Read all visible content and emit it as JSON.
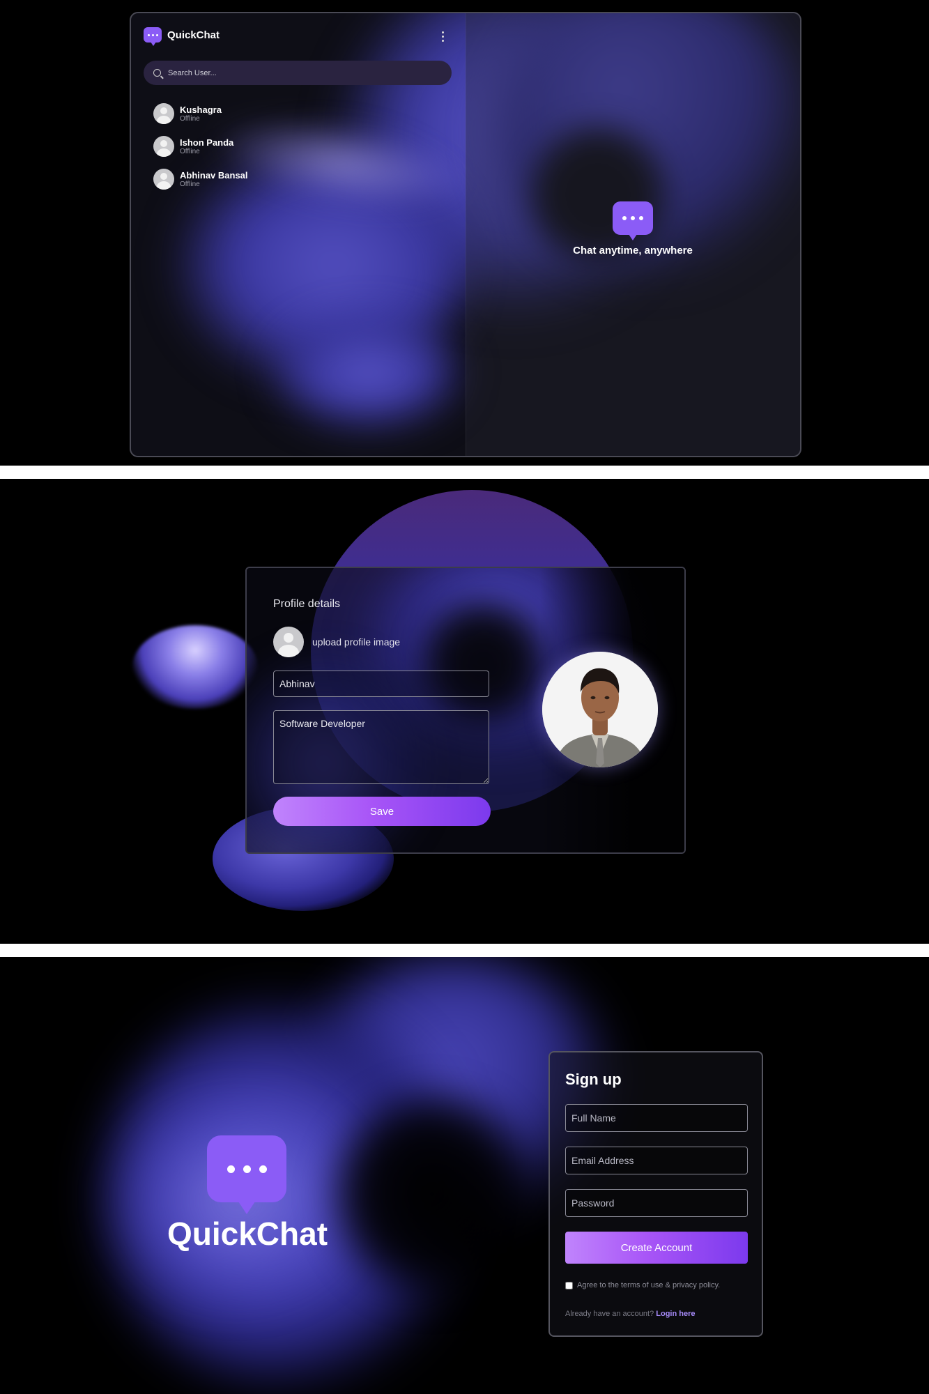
{
  "chat_screen": {
    "app_name": "QuickChat",
    "menu_icon": "vertical-dots-icon",
    "search": {
      "placeholder": "Search User...",
      "icon": "search-icon"
    },
    "users": [
      {
        "name": "Kushagra",
        "status": "Offline"
      },
      {
        "name": "Ishon Panda",
        "status": "Offline"
      },
      {
        "name": "Abhinav Bansal",
        "status": "Offline"
      }
    ],
    "welcome_text": "Chat anytime, anywhere"
  },
  "profile_screen": {
    "title": "Profile details",
    "upload_label": "upload profile image",
    "name_value": "Abhinav",
    "bio_value": "Software Developer",
    "save_label": "Save"
  },
  "signup_screen": {
    "brand_name": "QuickChat",
    "title": "Sign up",
    "full_name_placeholder": "Full Name",
    "email_placeholder": "Email Address",
    "password_placeholder": "Password",
    "create_label": "Create Account",
    "terms_text": "Agree to the terms of use & privacy policy.",
    "login_prompt": "Already have an account?",
    "login_link": "Login here"
  },
  "colors": {
    "accent": "#8b5cf6",
    "button_gradient_start": "#c084fc",
    "button_gradient_end": "#7c3aed",
    "background": "#000000",
    "link": "#a78bfa"
  }
}
